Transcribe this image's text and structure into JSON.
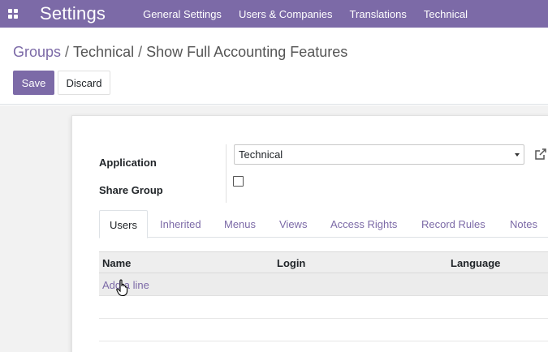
{
  "navbar": {
    "app_title": "Settings",
    "apps_icon": "grid-icon",
    "menu": [
      "General Settings",
      "Users & Companies",
      "Translations",
      "Technical"
    ],
    "color": "#7c6aa7"
  },
  "breadcrumb": {
    "groups": "Groups",
    "separator": "/",
    "category": "Technical",
    "current": "Show Full Accounting Features"
  },
  "buttons": {
    "save": "Save",
    "discard": "Discard"
  },
  "form": {
    "application_label": "Application",
    "application_value": "Technical",
    "share_group_label": "Share Group",
    "share_group_checked": false,
    "external_link_icon": "external-link-icon"
  },
  "tabs": [
    "Users",
    "Inherited",
    "Menus",
    "Views",
    "Access Rights",
    "Record Rules",
    "Notes"
  ],
  "active_tab": "Users",
  "table": {
    "columns": [
      "Name",
      "Login",
      "Language"
    ],
    "add_line": "Add a line"
  }
}
